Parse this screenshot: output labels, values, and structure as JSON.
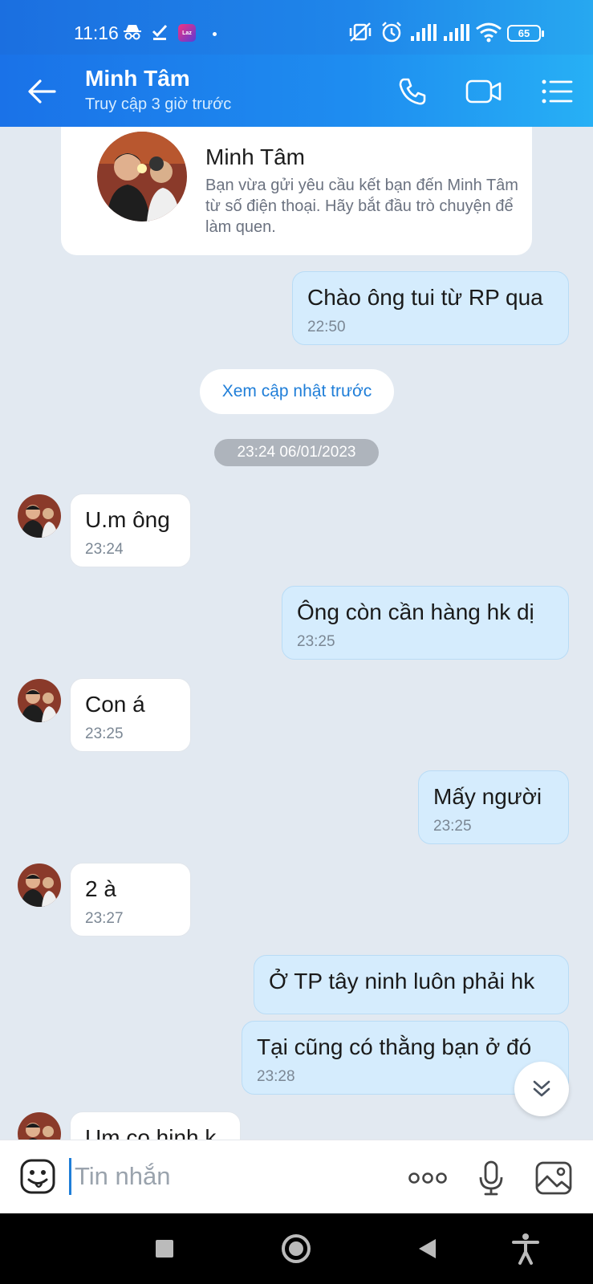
{
  "status_bar": {
    "time": "11:16",
    "lazada": "Laz",
    "battery": "65"
  },
  "header": {
    "name": "Minh Tâm",
    "status": "Truy cập 3 giờ trước"
  },
  "profile_card": {
    "name": "Minh Tâm",
    "description": "Bạn vừa gửi yêu cầu kết bạn đến Minh Tâm từ số điện thoại. Hãy bắt đầu trò chuyện để làm quen."
  },
  "load_previous": "Xem cập nhật trước",
  "date_separator": "23:24 06/01/2023",
  "messages": [
    {
      "dir": "out",
      "text": "Chào ông tui từ RP qua",
      "time": "22:50"
    },
    {
      "dir": "in",
      "text": "U.m ông",
      "time": "23:24"
    },
    {
      "dir": "out",
      "text": "Ông còn cần hàng hk dị",
      "time": "23:25"
    },
    {
      "dir": "in",
      "text": "Con á",
      "time": "23:25"
    },
    {
      "dir": "out",
      "text": "Mấy người",
      "time": "23:25"
    },
    {
      "dir": "in",
      "text": "2 à",
      "time": "23:27"
    },
    {
      "dir": "out",
      "text": "Ở TP tây ninh luôn phải hk",
      "time": ""
    },
    {
      "dir": "out",
      "text": "Tại cũng có thằng bạn ở đó",
      "time": "23:28"
    },
    {
      "dir": "in",
      "text": "Um co hinh k",
      "time": ""
    }
  ],
  "input": {
    "placeholder": "Tin nhắn",
    "value": ""
  },
  "colors": {
    "accent": "#1f86ea",
    "bubble_out": "#d5ecfd",
    "bubble_in": "#ffffff",
    "background": "#e2e9f1"
  }
}
